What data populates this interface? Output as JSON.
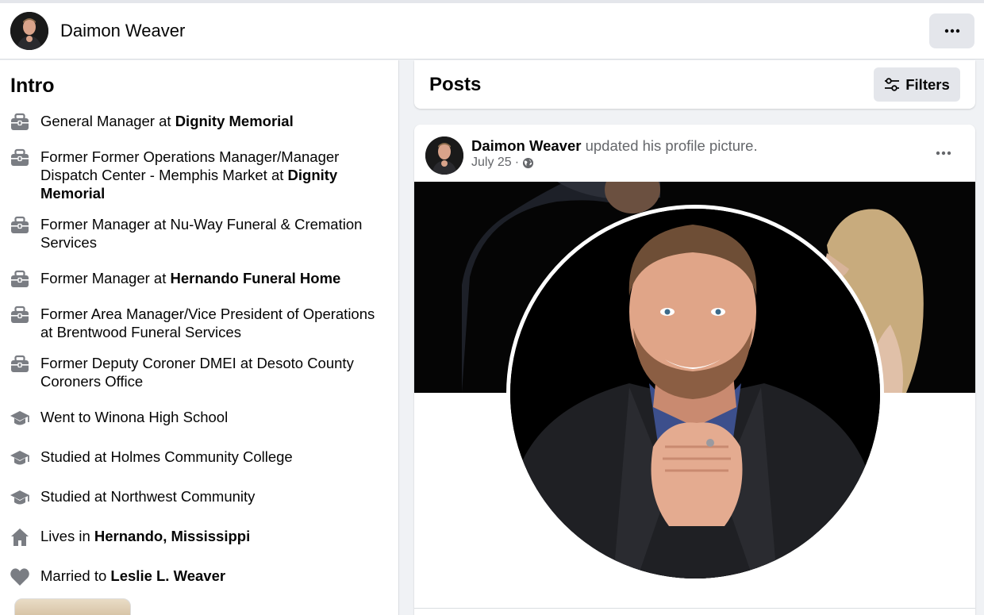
{
  "profile": {
    "name": "Daimon Weaver"
  },
  "header": {
    "more_icon": "more-horizontal-icon"
  },
  "intro": {
    "title": "Intro",
    "items": [
      {
        "icon": "briefcase-icon",
        "prefix": "General Manager at ",
        "bold": "Dignity Memorial"
      },
      {
        "icon": "briefcase-icon",
        "prefix": "Former Former Operations Manager/Manager Dispatch Center - Memphis Market at ",
        "bold": "Dignity Memorial"
      },
      {
        "icon": "briefcase-icon",
        "prefix": "Former Manager at Nu-Way Funeral & Cremation Services",
        "bold": ""
      },
      {
        "icon": "briefcase-icon",
        "prefix": "Former Manager at ",
        "bold": "Hernando Funeral Home"
      },
      {
        "icon": "briefcase-icon",
        "prefix": "Former Area Manager/Vice President of Operations at Brentwood Funeral Services",
        "bold": ""
      },
      {
        "icon": "briefcase-icon",
        "prefix": "Former Deputy Coroner DMEI at Desoto County Coroners Office",
        "bold": ""
      },
      {
        "icon": "graduation-cap-icon",
        "prefix": "Went to Winona High School",
        "bold": ""
      },
      {
        "icon": "graduation-cap-icon",
        "prefix": "Studied at Holmes Community College",
        "bold": ""
      },
      {
        "icon": "graduation-cap-icon",
        "prefix": "Studied at Northwest Community",
        "bold": ""
      },
      {
        "icon": "home-icon",
        "prefix": "Lives in ",
        "bold": "Hernando, Mississippi"
      },
      {
        "icon": "heart-icon",
        "prefix": "Married to ",
        "bold": "Leslie L. Weaver"
      }
    ]
  },
  "posts": {
    "title": "Posts",
    "filters_label": "Filters"
  },
  "post": {
    "author": "Daimon Weaver",
    "action": " updated his profile picture.",
    "date": "July 25",
    "separator": "·",
    "privacy_icon": "globe-icon"
  },
  "colors": {
    "background": "#f0f2f5",
    "card": "#ffffff",
    "button_gray": "#e4e6eb",
    "icon_gray": "#65676b",
    "secondary_text": "#65676b"
  }
}
